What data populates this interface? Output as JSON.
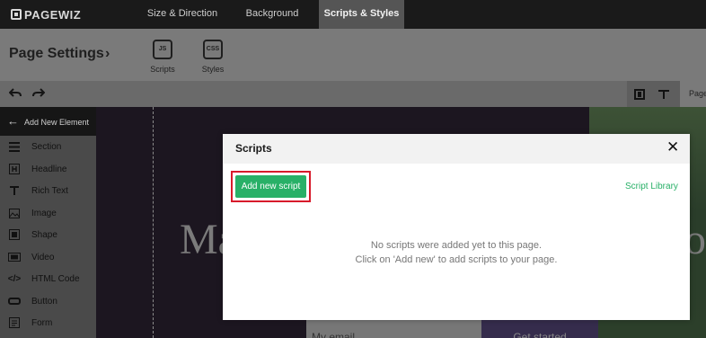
{
  "app": {
    "logo": "PAGEWIZ"
  },
  "top_tabs": [
    {
      "label": "Size & Direction"
    },
    {
      "label": "Background"
    },
    {
      "label": "Scripts & Styles",
      "active": true
    }
  ],
  "settings_bar": {
    "title": "Page Settings",
    "chevron": "›",
    "code_buttons": [
      {
        "icon": "JS",
        "label": "Scripts"
      },
      {
        "icon": "CSS",
        "label": "Styles"
      }
    ]
  },
  "toolbar": {
    "undo_icon": "undo-icon",
    "redo_icon": "redo-icon",
    "page_tab": "Page"
  },
  "elements_panel": {
    "header": "Add New Element",
    "items": [
      {
        "label": "Section",
        "icon": "section-icon"
      },
      {
        "label": "Headline",
        "icon": "headline-icon"
      },
      {
        "label": "Rich Text",
        "icon": "rich-text-icon"
      },
      {
        "label": "Image",
        "icon": "image-icon"
      },
      {
        "label": "Shape",
        "icon": "shape-icon"
      },
      {
        "label": "Video",
        "icon": "video-icon"
      },
      {
        "label": "HTML Code",
        "icon": "html-code-icon"
      },
      {
        "label": "Button",
        "icon": "button-icon"
      },
      {
        "label": "Form",
        "icon": "form-icon"
      }
    ]
  },
  "canvas": {
    "hero_left": "Ma",
    "hero_right": "on",
    "email_placeholder": "My email",
    "cta_label": "Get started"
  },
  "modal": {
    "title": "Scripts",
    "close": "✕",
    "add_button": "Add new script",
    "library_link": "Script Library",
    "empty_line1": "No scripts were added yet to this page.",
    "empty_line2": "Click on 'Add new' to add scripts to your page."
  },
  "colors": {
    "accent_green": "#28b067",
    "highlight_red": "#d81b2b"
  }
}
